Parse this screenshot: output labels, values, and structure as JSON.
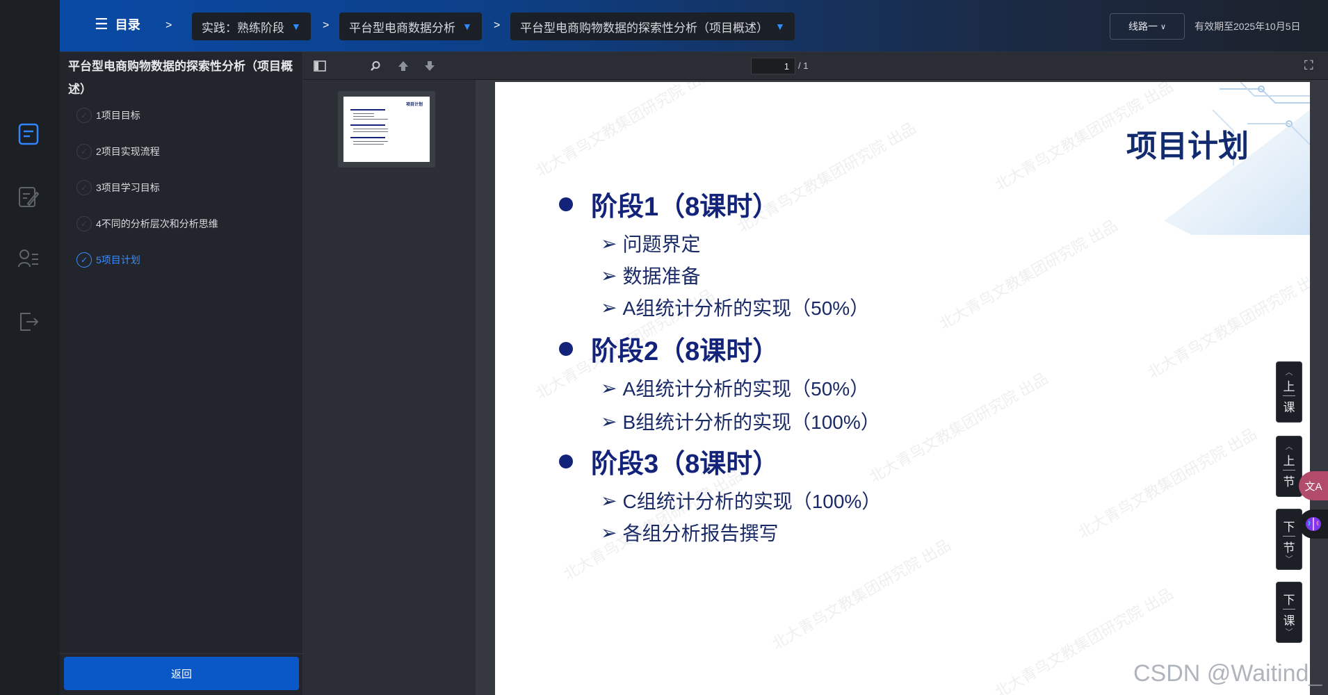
{
  "header": {
    "menu_label": "目录",
    "crumb_sep": ">",
    "crumbs": [
      "实践：熟练阶段",
      "平台型电商数据分析",
      "平台型电商购物数据的探索性分析（项目概述）"
    ],
    "crumb_arrow": "▼",
    "route_label": "线路一",
    "expiry": "有效期至2025年10月5日"
  },
  "sidebar": {
    "title": "平台型电商购物数据的探索性分析（项目概述）",
    "lessons": [
      {
        "label": "1项目目标",
        "active": false
      },
      {
        "label": "2项目实现流程",
        "active": false
      },
      {
        "label": "3项目学习目标",
        "active": false
      },
      {
        "label": "4不同的分析层次和分析思维",
        "active": false
      },
      {
        "label": "5项目计划",
        "active": true
      }
    ],
    "back_label": "返回"
  },
  "rail": {
    "icons": [
      "courseware-icon",
      "notes-edit-icon",
      "user-list-icon",
      "exit-icon"
    ]
  },
  "pdf": {
    "page_current": "1",
    "page_total": "/ 1"
  },
  "slide": {
    "title": "项目计划",
    "stages": [
      {
        "title": "阶段1（8课时）",
        "items": [
          "问题界定",
          "数据准备",
          "A组统计分析的实现（50%）"
        ]
      },
      {
        "title": "阶段2（8课时）",
        "items": [
          "A组统计分析的实现（50%）",
          "B组统计分析的实现（100%）"
        ]
      },
      {
        "title": "阶段3（8课时）",
        "items": [
          "C组统计分析的实现（100%）",
          "各组分析报告撰写"
        ]
      }
    ],
    "bullet_marker": "➢",
    "watermark_text": "北大青鸟文教集团研究院 出品",
    "thumb_title": "项目计划"
  },
  "right_nav": {
    "prev_lesson": [
      "上",
      "课"
    ],
    "prev_section": [
      "上",
      "节"
    ],
    "next_section": [
      "下",
      "节"
    ],
    "next_lesson": [
      "下",
      "课"
    ]
  },
  "floating": {
    "translate_label": "文A"
  },
  "csdn_mark": "CSDN @Waitind_"
}
